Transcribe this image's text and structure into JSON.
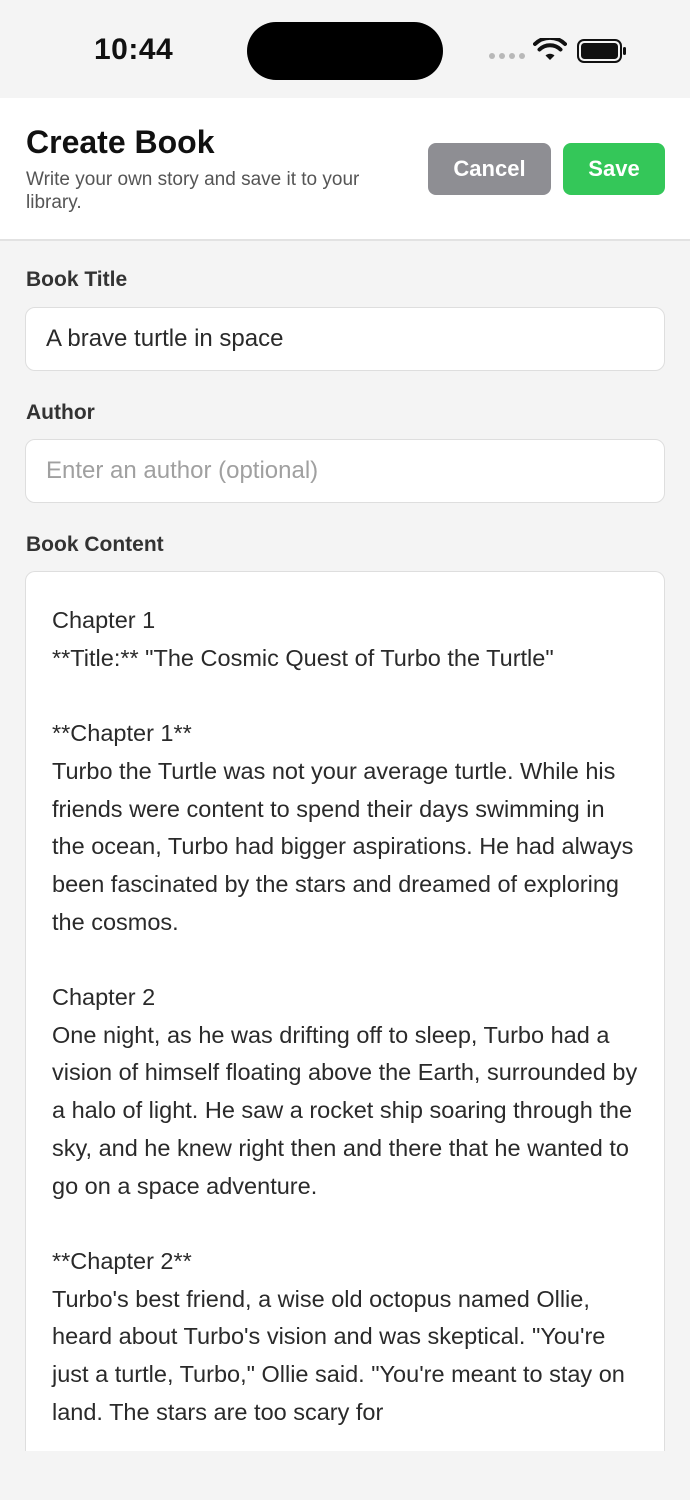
{
  "status_bar": {
    "time": "10:44"
  },
  "header": {
    "title": "Create Book",
    "subtitle": "Write your own story and save it to your library.",
    "cancel_label": "Cancel",
    "save_label": "Save"
  },
  "form": {
    "title_label": "Book Title",
    "title_value": "A brave turtle in space",
    "author_label": "Author",
    "author_placeholder": "Enter an author (optional)",
    "content_label": "Book Content",
    "content_value": "Chapter 1\n**Title:** \"The Cosmic Quest of Turbo the Turtle\"\n\n**Chapter 1**\nTurbo the Turtle was not your average turtle. While his friends were content to spend their days swimming in the ocean, Turbo had bigger aspirations. He had always been fascinated by the stars and dreamed of exploring the cosmos.\n\nChapter 2\nOne night, as he was drifting off to sleep, Turbo had a vision of himself floating above the Earth, surrounded by a halo of light. He saw a rocket ship soaring through the sky, and he knew right then and there that he wanted to go on a space adventure.\n\n**Chapter 2**\nTurbo's best friend, a wise old octopus named Ollie, heard about Turbo's vision and was skeptical. \"You're just a turtle, Turbo,\" Ollie said. \"You're meant to stay on land. The stars are too scary for"
  },
  "colors": {
    "cancel_bg": "#8e8e93",
    "save_bg": "#34c759",
    "page_bg": "#f4f4f4"
  },
  "icons": {
    "signal": "signal-dots-icon",
    "wifi": "wifi-icon",
    "battery": "battery-icon"
  }
}
